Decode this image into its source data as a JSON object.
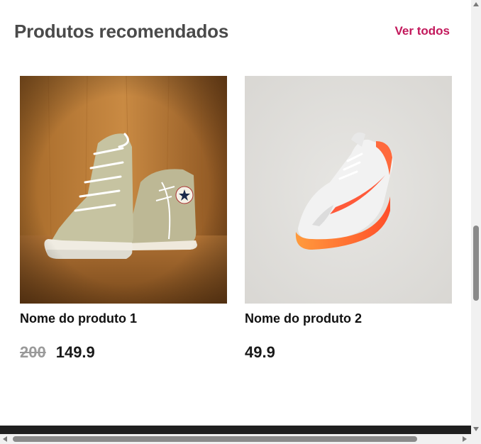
{
  "section": {
    "title": "Produtos recomendados",
    "see_all_label": "Ver todos",
    "accent_color": "#c2185b"
  },
  "products": [
    {
      "name": "Nome do produto 1",
      "old_price": "200",
      "price": "149.9",
      "image_subject": "high-top canvas sneakers on wooden background"
    },
    {
      "name": "Nome do produto 2",
      "old_price": "",
      "price": "49.9",
      "image_subject": "white and orange running sneaker on light gray background"
    }
  ]
}
